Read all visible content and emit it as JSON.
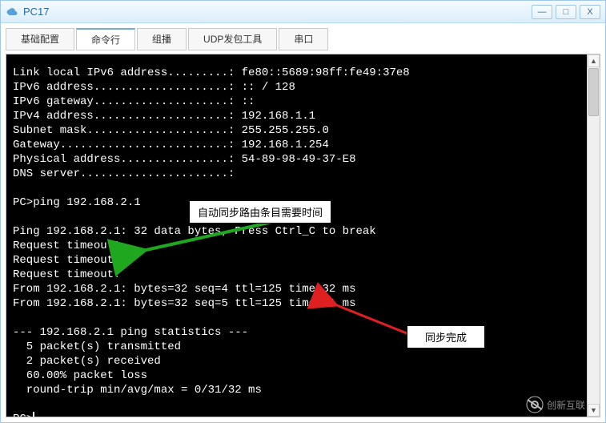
{
  "window": {
    "title": "PC17",
    "minimize_glyph": "—",
    "maximize_glyph": "□",
    "close_glyph": "X"
  },
  "tabs": {
    "items": [
      {
        "label": "基础配置"
      },
      {
        "label": "命令行"
      },
      {
        "label": "组播"
      },
      {
        "label": "UDP发包工具"
      },
      {
        "label": "串口"
      }
    ],
    "active_index": 1
  },
  "terminal": {
    "lines": [
      "Link local IPv6 address.........: fe80::5689:98ff:fe49:37e8",
      "IPv6 address....................: :: / 128",
      "IPv6 gateway....................: ::",
      "IPv4 address....................: 192.168.1.1",
      "Subnet mask.....................: 255.255.255.0",
      "Gateway.........................: 192.168.1.254",
      "Physical address................: 54-89-98-49-37-E8",
      "DNS server......................:",
      "",
      "PC>ping 192.168.2.1",
      "",
      "Ping 192.168.2.1: 32 data bytes, Press Ctrl_C to break",
      "Request timeout!",
      "Request timeout!",
      "Request timeout!",
      "From 192.168.2.1: bytes=32 seq=4 ttl=125 time=32 ms",
      "From 192.168.2.1: bytes=32 seq=5 ttl=125 time=31 ms",
      "",
      "--- 192.168.2.1 ping statistics ---",
      "  5 packet(s) transmitted",
      "  2 packet(s) received",
      "  60.00% packet loss",
      "  round-trip min/avg/max = 0/31/32 ms",
      "",
      "PC>"
    ],
    "prompt_end": "PC>"
  },
  "annotations": {
    "label_top": "自动同步路由条目需要时间",
    "label_bottom": "同步完成"
  },
  "watermark": "创新互联"
}
